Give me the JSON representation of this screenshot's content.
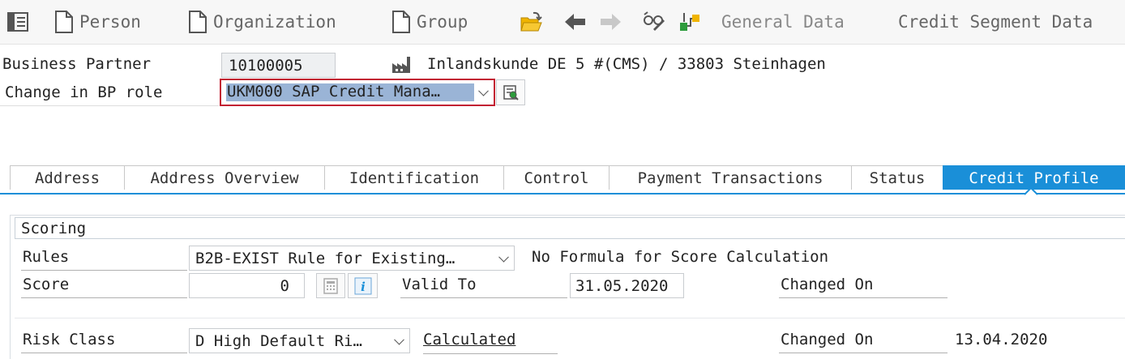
{
  "toolbar": {
    "person_label": "Person",
    "organization_label": "Organization",
    "group_label": "Group",
    "general_data_label": "General Data",
    "credit_segment_label": "Credit Segment Data"
  },
  "header": {
    "bp_label": "Business Partner",
    "bp_value": "10100005",
    "bp_description": "Inlandskunde DE 5 #(CMS) / 33803 Steinhagen",
    "role_label": "Change in BP role",
    "role_value": "UKM000 SAP Credit Mana…"
  },
  "tabs": [
    {
      "label": "Address"
    },
    {
      "label": "Address Overview"
    },
    {
      "label": "Identification"
    },
    {
      "label": "Control"
    },
    {
      "label": "Payment Transactions"
    },
    {
      "label": "Status"
    },
    {
      "label": "Credit Profile"
    }
  ],
  "scoring": {
    "section_title": "Scoring",
    "rules_label": "Rules",
    "rules_value": "B2B-EXIST Rule for Existing…",
    "formula_note": "No Formula for Score Calculation",
    "score_label": "Score",
    "score_value": "0",
    "valid_to_label": "Valid To",
    "valid_to_value": "31.05.2020",
    "changed_on_label": "Changed On",
    "risk_class_label": "Risk Class",
    "risk_class_value": "D High Default Ri…",
    "calculated_link": "Calculated",
    "changed_on_label_2": "Changed On",
    "changed_on_value_2": "13.04.2020"
  },
  "colors": {
    "accent": "#1a8fd8",
    "toolbar_bg": "#f7f7f7",
    "selection": "#9ab4d6"
  }
}
